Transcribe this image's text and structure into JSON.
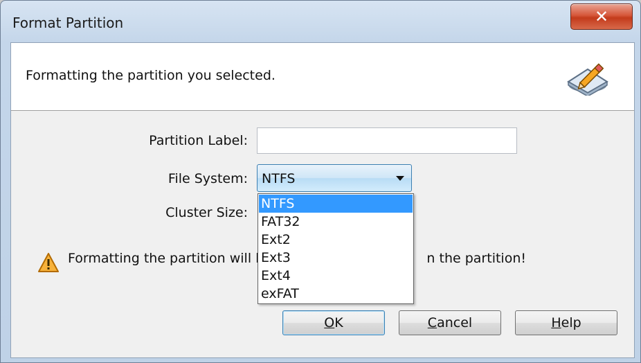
{
  "window": {
    "title": "Format Partition",
    "close_label": "✕"
  },
  "header": {
    "text": "Formatting the partition you selected.",
    "icon": "disk-pencil-icon"
  },
  "form": {
    "partition_label": {
      "label": "Partition Label:",
      "value": "",
      "placeholder": ""
    },
    "file_system": {
      "label": "File System:",
      "selected": "NTFS",
      "options": [
        "NTFS",
        "FAT32",
        "Ext2",
        "Ext3",
        "Ext4",
        "exFAT"
      ],
      "highlighted_index": 0
    },
    "cluster_size": {
      "label": "Cluster Size:"
    }
  },
  "warning": {
    "icon": "warning-icon",
    "text_start": "Formatting the partition will l",
    "text_end": "n the partition!"
  },
  "buttons": {
    "ok": {
      "mnemonic": "O",
      "rest": "K"
    },
    "cancel": {
      "mnemonic": "C",
      "rest": "ancel"
    },
    "help": {
      "mnemonic": "H",
      "rest": "elp"
    }
  },
  "colors": {
    "selection": "#3399ff",
    "title_gradient_top": "#d7e4f2",
    "close_button": "#c33b1c"
  }
}
